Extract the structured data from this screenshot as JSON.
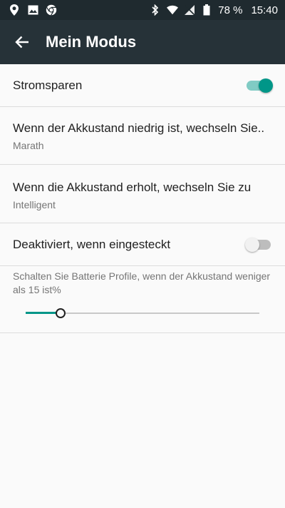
{
  "status_bar": {
    "battery_percent": "78 %",
    "time": "15:40",
    "left_icons": [
      "location-icon",
      "image-icon",
      "chrome-icon"
    ],
    "right_icons": [
      "bluetooth-icon",
      "wifi-icon",
      "no-signal-icon",
      "battery-icon"
    ]
  },
  "app_bar": {
    "title": "Mein Modus",
    "background": "#263238"
  },
  "settings": {
    "power_saving": {
      "label": "Stromsparen",
      "enabled": true
    },
    "low_battery": {
      "title": "Wenn der Akkustand niedrig ist, wechseln Sie..",
      "value": "Marath"
    },
    "recovered": {
      "title": "Wenn die Akkustand erholt, wechseln Sie zu",
      "value": "Intelligent"
    },
    "disable_plugged": {
      "label": "Deaktiviert, wenn eingesteckt",
      "enabled": false
    },
    "threshold": {
      "label": "Schalten Sie Batterie Profile, wenn der Akkustand weniger als 15 ist%",
      "value_fraction": 0.15
    }
  },
  "colors": {
    "accent": "#009688",
    "accent_light": "#80cbc4"
  }
}
